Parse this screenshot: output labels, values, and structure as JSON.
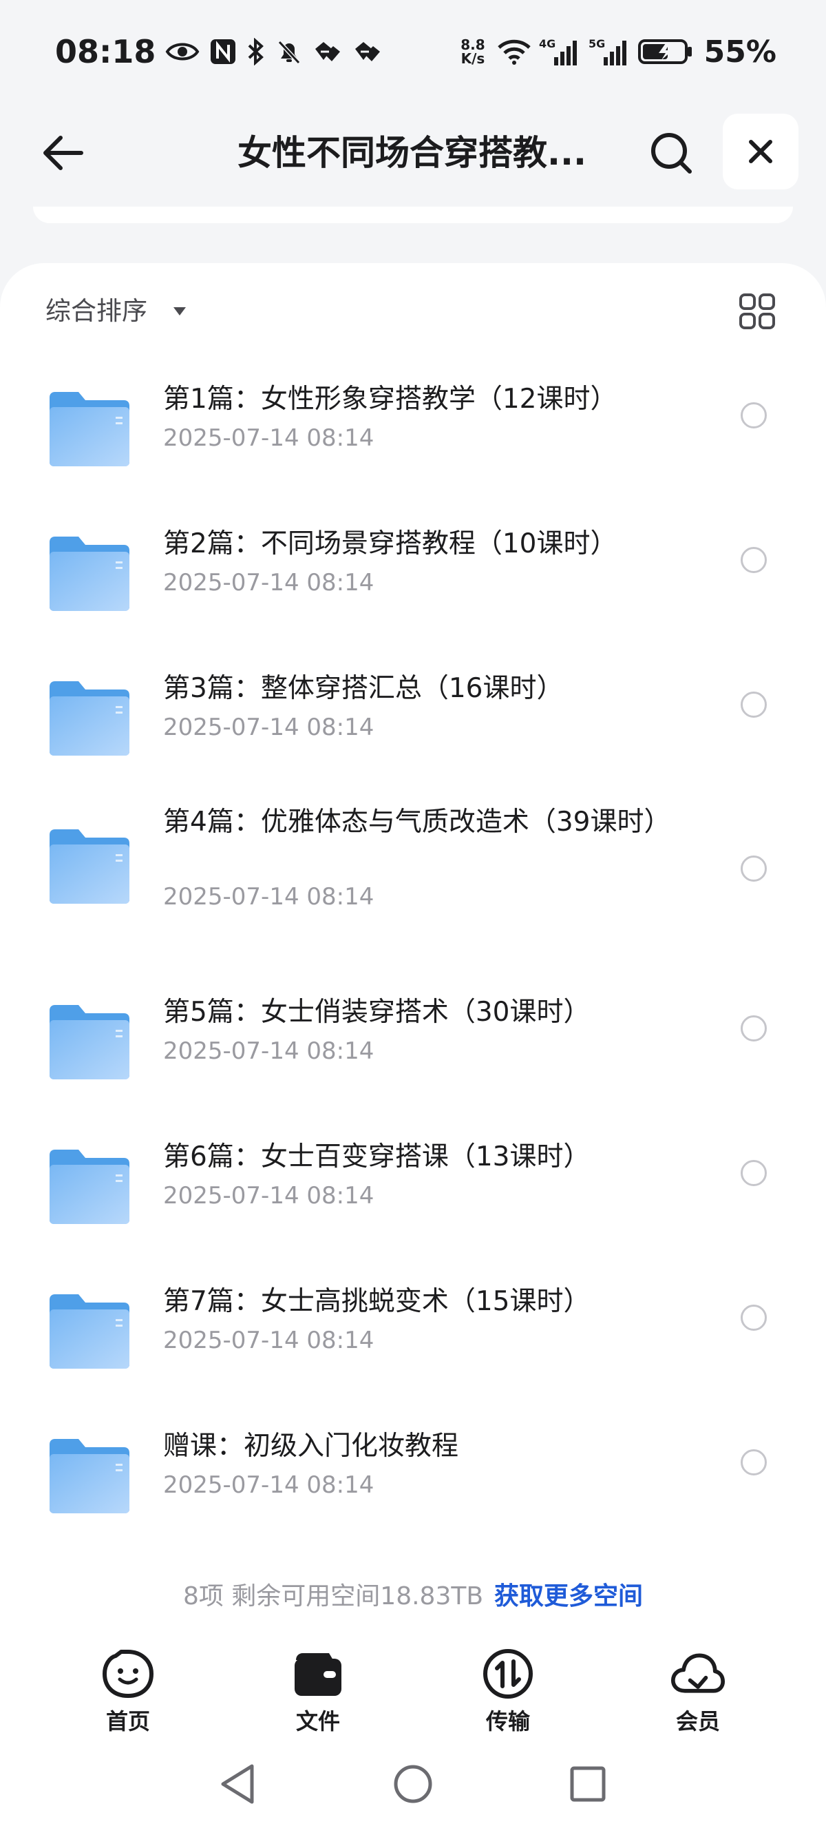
{
  "status_bar": {
    "time": "08:18",
    "net_speed_value": "8.8",
    "net_speed_unit": "K/s",
    "net_4g": "4G",
    "net_5g": "5G",
    "battery": "55%"
  },
  "header": {
    "title": "女性不同场合穿搭教...",
    "icons": [
      "back-arrow-icon",
      "search-icon",
      "close-icon"
    ]
  },
  "toolbar": {
    "sort_label": "综合排序"
  },
  "files": [
    {
      "name": "第1篇：女性形象穿搭教学（12课时）",
      "date": "2025-07-14 08:14"
    },
    {
      "name": "第2篇：不同场景穿搭教程（10课时）",
      "date": "2025-07-14 08:14"
    },
    {
      "name": "第3篇：整体穿搭汇总（16课时）",
      "date": "2025-07-14 08:14"
    },
    {
      "name": "第4篇：优雅体态与气质改造术（39课时）",
      "date": "2025-07-14 08:14"
    },
    {
      "name": "第5篇：女士俏装穿搭术（30课时）",
      "date": "2025-07-14 08:14"
    },
    {
      "name": "第6篇：女士百变穿搭课（13课时）",
      "date": "2025-07-14 08:14"
    },
    {
      "name": "第7篇：女士高挑蜕变术（15课时）",
      "date": "2025-07-14 08:14"
    },
    {
      "name": "赠课：初级入门化妆教程",
      "date": "2025-07-14 08:14"
    }
  ],
  "footer": {
    "summary": "8项 剩余可用空间18.83TB",
    "link": "获取更多空间"
  },
  "bottom_nav": [
    {
      "label": "首页",
      "icon": "smile-face-icon"
    },
    {
      "label": "文件",
      "icon": "wallet-folder-icon"
    },
    {
      "label": "传输",
      "icon": "transfer-icon"
    },
    {
      "label": "会员",
      "icon": "cloud-icon"
    }
  ],
  "colors": {
    "accent_link": "#1f5bd8",
    "folder_blue": "#6fb0f2",
    "background": "#f4f5f7"
  }
}
